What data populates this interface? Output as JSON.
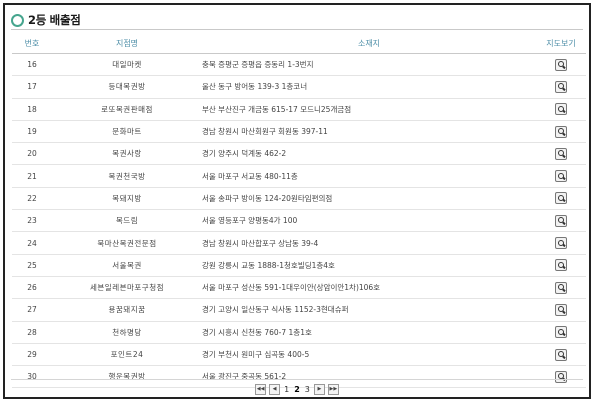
{
  "header": {
    "title": "2등 배출점"
  },
  "columns": {
    "num": "번호",
    "name": "지점명",
    "address": "소재지",
    "map": "지도보기"
  },
  "rows": [
    {
      "num": "16",
      "name": "대일마켓",
      "address": "충북 증평군 증평읍 증동리 1-3번지"
    },
    {
      "num": "17",
      "name": "등대복권방",
      "address": "울산 동구 방어동 139-3 1층코너"
    },
    {
      "num": "18",
      "name": "로또복권판매점",
      "address": "부산 부산진구 개금동 615-17 모드니25개금점"
    },
    {
      "num": "19",
      "name": "문화마트",
      "address": "경남 창원시 마산회원구 회원동 397-11"
    },
    {
      "num": "20",
      "name": "복권사랑",
      "address": "경기 양주시 덕계동 462-2"
    },
    {
      "num": "21",
      "name": "복권천국방",
      "address": "서울 마포구 서교동 480-11층"
    },
    {
      "num": "22",
      "name": "복돼지방",
      "address": "서울 송파구 방이동 124-20원타임편의점"
    },
    {
      "num": "23",
      "name": "복드림",
      "address": "서울 영등포구 양평동4가 100"
    },
    {
      "num": "24",
      "name": "북마산복권전문점",
      "address": "경남 창원시 마산합포구 상남동 39-4"
    },
    {
      "num": "25",
      "name": "서울복권",
      "address": "강원 강릉시 교동 1888-1청호빌딩1층4호"
    },
    {
      "num": "26",
      "name": "세븐일레븐마포구청점",
      "address": "서울 마포구 성산동 591-1대우이안(상암이안1차)106호"
    },
    {
      "num": "27",
      "name": "용꿈돼지꿈",
      "address": "경기 고양시 일산동구 식사동 1152-3현대슈퍼"
    },
    {
      "num": "28",
      "name": "천하명당",
      "address": "경기 시흥시 신천동 760-7 1층1호"
    },
    {
      "num": "29",
      "name": "포인트24",
      "address": "경기 부천시 원미구 심곡동 400-5"
    },
    {
      "num": "30",
      "name": "행운복권방",
      "address": "서울 광진구 중곡동 561-2"
    }
  ],
  "pagination": {
    "first": "◀◀",
    "prev": "◀",
    "next": "▶",
    "last": "▶▶",
    "pages": [
      "1",
      "2",
      "3"
    ],
    "current": "2"
  },
  "colors": {
    "accent": "#46a58e",
    "header_text": "#4f8fa8"
  },
  "icons": {
    "title": "circle-icon",
    "map": "magnifier-icon"
  }
}
